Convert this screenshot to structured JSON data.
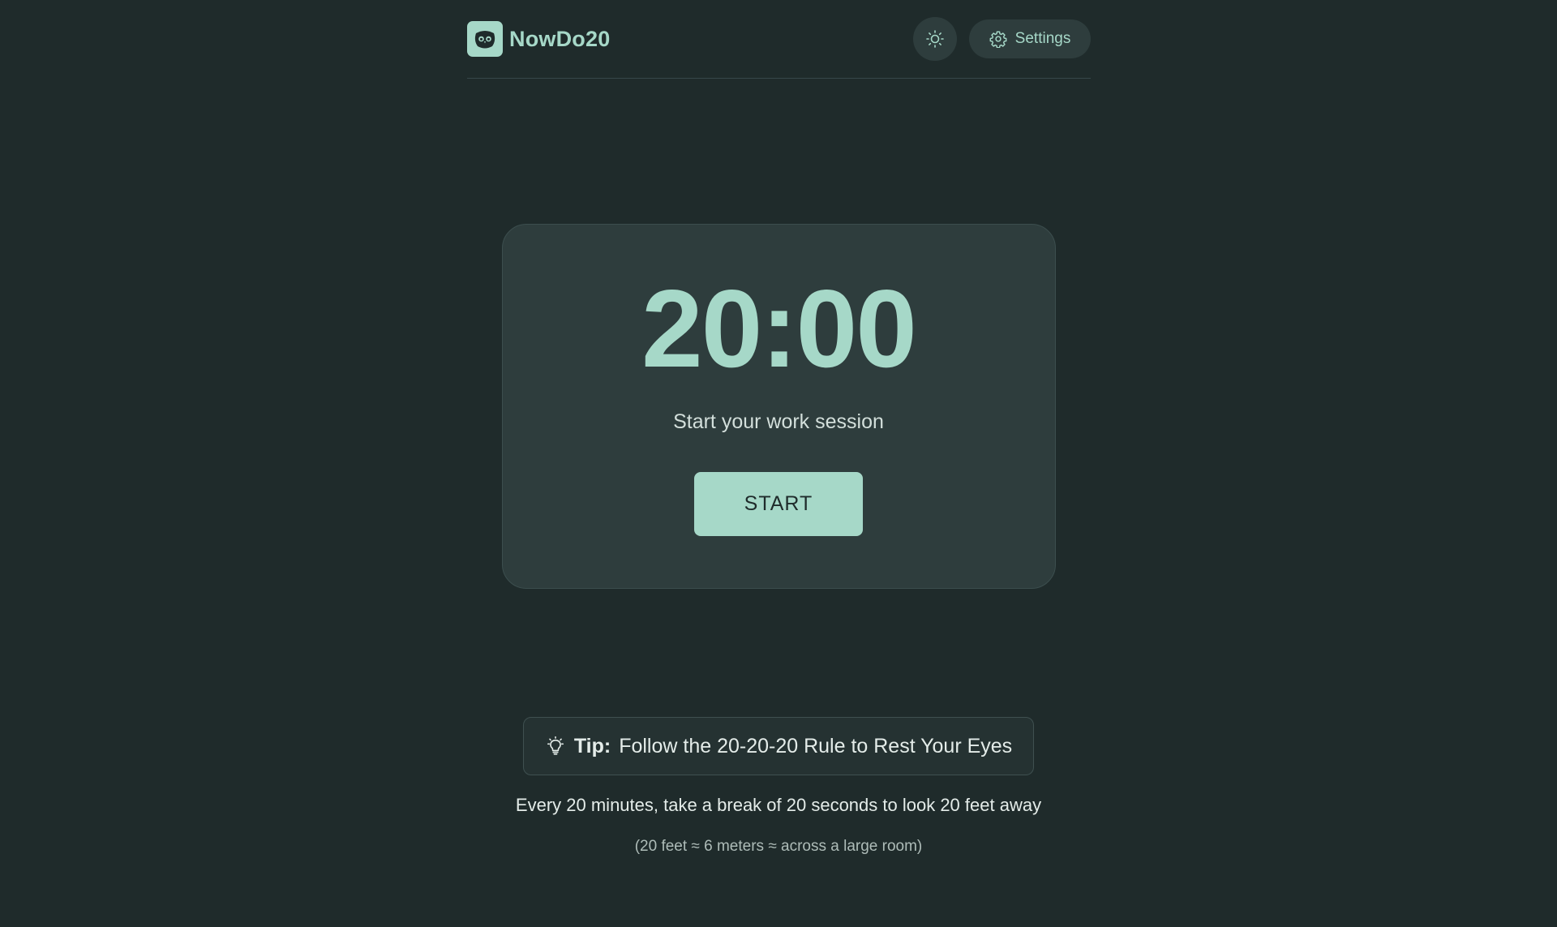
{
  "app": {
    "name": "NowDo20",
    "logo_icon": "owl-icon"
  },
  "header": {
    "theme_toggle_icon": "sun-icon",
    "settings_label": "Settings",
    "settings_icon": "gear-icon"
  },
  "timer": {
    "time": "20:00",
    "status": "Start your work session",
    "start_label": "START"
  },
  "tip": {
    "icon": "lightbulb-icon",
    "label": "Tip:",
    "text": "Follow the 20-20-20 Rule to Rest Your Eyes",
    "rule": "Every 20 minutes, take a break of 20 seconds to look 20 feet away",
    "note": "(20 feet ≈ 6 meters ≈ across a large room)"
  },
  "colors": {
    "background": "#1f2b2b",
    "surface": "#2e3d3d",
    "accent": "#a6d8c8",
    "text": "#e4ece9"
  }
}
